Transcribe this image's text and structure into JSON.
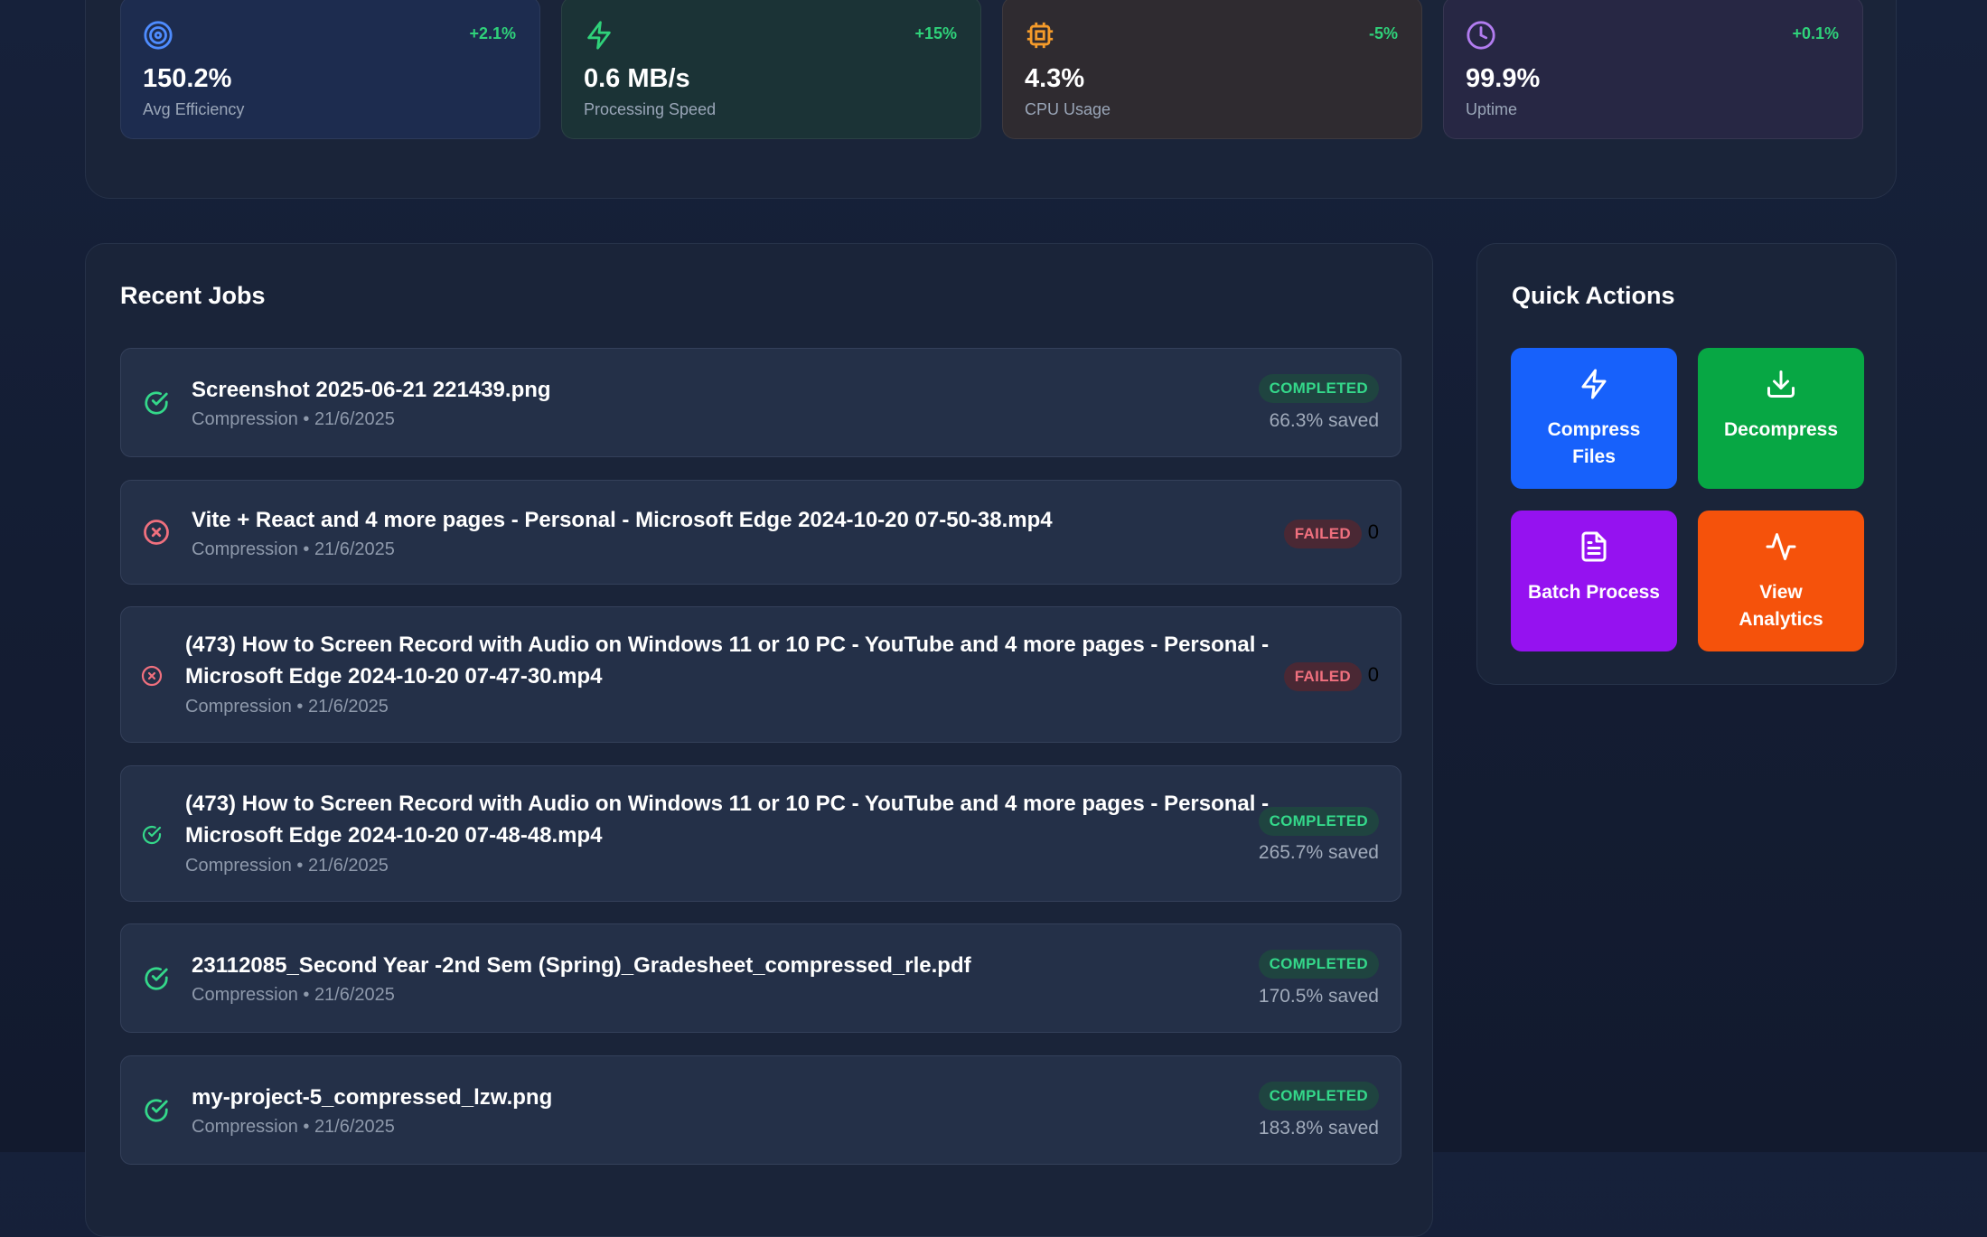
{
  "stats": [
    {
      "icon": "target-icon",
      "value": "150.2%",
      "label": "Avg Efficiency",
      "change": "+2.1%"
    },
    {
      "icon": "lightning-icon",
      "value": "0.6 MB/s",
      "label": "Processing Speed",
      "change": "+15%"
    },
    {
      "icon": "cpu-icon",
      "value": "4.3%",
      "label": "CPU Usage",
      "change": "-5%"
    },
    {
      "icon": "clock-icon",
      "value": "99.9%",
      "label": "Uptime",
      "change": "+0.1%"
    }
  ],
  "recent_jobs": {
    "title": "Recent Jobs",
    "items": [
      {
        "name": "Screenshot 2025-06-21 221439.png",
        "meta": "Compression • 21/6/2025",
        "status": "COMPLETED",
        "saved": "66.3% saved",
        "icon": "check-circle-icon"
      },
      {
        "name": "Vite + React and 4 more pages - Personal - Microsoft Edge 2024-10-20 07-50-38.mp4",
        "meta": "Compression • 21/6/2025",
        "status": "FAILED",
        "extra": "0",
        "icon": "x-circle-icon"
      },
      {
        "name_line1": "(473) How to Screen Record with Audio on Windows 11 or 10 PC - YouTube and 4 more pages - Personal -",
        "name_line2": "Microsoft Edge 2024-10-20 07-47-30.mp4",
        "meta": "Compression • 21/6/2025",
        "status": "FAILED",
        "extra": "0",
        "icon": "x-circle-icon"
      },
      {
        "name_line1": "(473) How to Screen Record with Audio on Windows 11 or 10 PC - YouTube and 4 more pages - Personal -",
        "name_line2": "Microsoft Edge 2024-10-20 07-48-48.mp4",
        "meta": "Compression • 21/6/2025",
        "status": "COMPLETED",
        "saved": "265.7% saved",
        "icon": "check-circle-icon"
      },
      {
        "name": "23112085_Second Year -2nd Sem (Spring)_Gradesheet_compressed_rle.pdf",
        "meta": "Compression • 21/6/2025",
        "status": "COMPLETED",
        "saved": "170.5% saved",
        "icon": "check-circle-icon"
      },
      {
        "name": "my-project-5_compressed_lzw.png",
        "meta": "Compression • 21/6/2025",
        "status": "COMPLETED",
        "saved": "183.8% saved",
        "icon": "check-circle-icon"
      }
    ]
  },
  "quick_actions": {
    "title": "Quick Actions",
    "buttons": [
      {
        "label_line1": "Compress",
        "label_line2": "Files",
        "icon": "lightning-icon",
        "color": "#1761fb"
      },
      {
        "label_line1": "Decompress",
        "label_line2": "",
        "icon": "download-icon",
        "color": "#07a744"
      },
      {
        "label_line1": "Batch Process",
        "label_line2": "",
        "icon": "document-icon",
        "color": "#9512f0"
      },
      {
        "label_line1": "View",
        "label_line2": "Analytics",
        "icon": "activity-icon",
        "color": "#f5520b"
      }
    ]
  },
  "colors": {
    "success": "#34d88a",
    "danger": "#f0707e",
    "background": "#141d33"
  }
}
